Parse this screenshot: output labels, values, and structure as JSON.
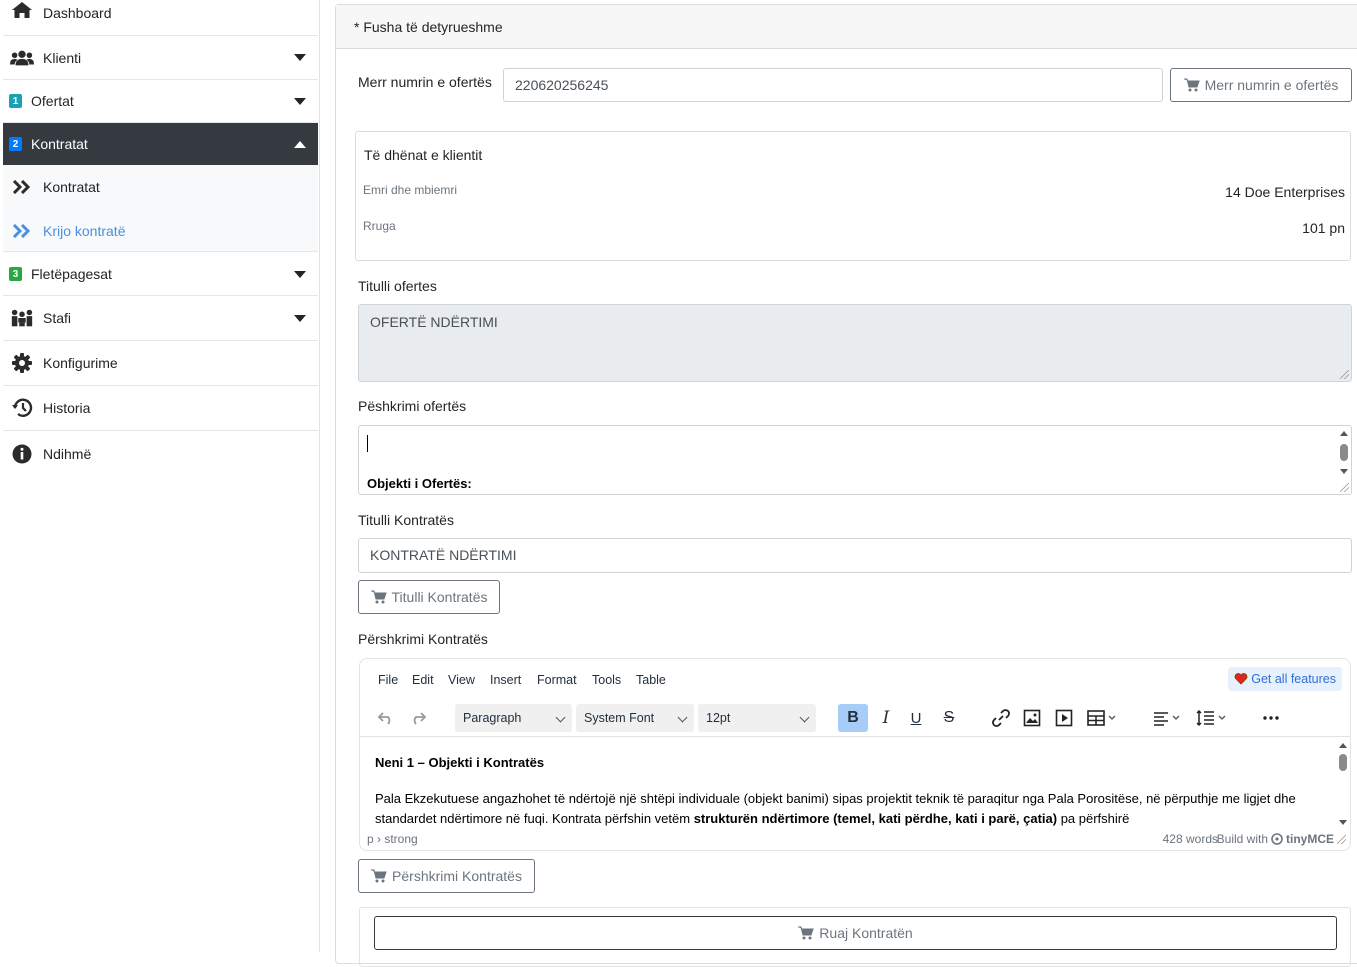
{
  "sidebar": {
    "items": [
      {
        "label": "Dashboard",
        "icon": "home-icon"
      },
      {
        "label": "Klienti",
        "icon": "users-icon"
      },
      {
        "label": "Ofertat",
        "badge": "1",
        "badge_color": "#17a2b8"
      },
      {
        "label": "Kontratat",
        "badge": "2",
        "badge_color": "#007bff"
      },
      {
        "label": "Fletëpagesat",
        "badge": "3",
        "badge_color": "#28a745"
      },
      {
        "label": "Stafi",
        "icon": "team-icon"
      },
      {
        "label": "Konfigurime",
        "icon": "gear-icon"
      },
      {
        "label": "Historia",
        "icon": "history-icon"
      },
      {
        "label": "Ndihmë",
        "icon": "info-icon"
      }
    ],
    "submenu": [
      {
        "label": "Kontratat",
        "icon": "double-chevron-right-icon"
      },
      {
        "label": "Krijo kontratë",
        "icon": "double-chevron-right-icon"
      }
    ]
  },
  "form": {
    "required_note": "* Fusha të detyrueshme",
    "offer_number_label": "Merr numrin e ofertës",
    "offer_number_value": "220620256245",
    "offer_number_button": "Merr numrin e ofertës",
    "client": {
      "title": "Të dhënat e klientit",
      "rows": [
        {
          "key": "Emri dhe mbiemri",
          "value": "14 Doe Enterprises"
        },
        {
          "key": "Rruga",
          "value": "101 pn"
        }
      ]
    },
    "offer_title_label": "Titulli ofertes",
    "offer_title_value": "OFERTË NDËRTIMI",
    "offer_desc_label": "Pëshkrimi ofertës",
    "offer_desc_content": "Objekti i Ofertës:",
    "contract_title_label": "Titulli Kontratës",
    "contract_title_value": "KONTRATË NDËRTIMI",
    "contract_title_button": "Titulli Kontratës",
    "contract_desc_label": "Përshkrimi Kontratës",
    "contract_desc_button": "Përshkrimi Kontratës",
    "save_button": "Ruaj Kontratën"
  },
  "editor": {
    "menu": [
      "File",
      "Edit",
      "View",
      "Insert",
      "Format",
      "Tools",
      "Table"
    ],
    "get_all_features": "Get all features",
    "block_format": "Paragraph",
    "font_family": "System Font",
    "font_size": "12pt",
    "heading": "Neni 1 – Objekti i Kontratës",
    "paragraph_start": "Pala Ekzekutuese angazhohet të ndërtojë një shtëpi individuale (objekt banimi) sipas projektit teknik të paraqitur nga Pala Porositëse, në përputhje me ligjet dhe standardet ndërtimore në fuqi. Kontrata përfshin vetëm ",
    "paragraph_bold": "strukturën ndërtimore (temel, kati përdhe, kati i parë, çatia)",
    "paragraph_end": " pa përfshirë",
    "path": "p › strong",
    "word_count": "428 words",
    "build_with": "Build with",
    "brand": "tinyMCE"
  },
  "colors": {
    "active_bg": "#343a40",
    "link_blue": "#4a90e2",
    "bold_active": "#a6ccf7"
  }
}
